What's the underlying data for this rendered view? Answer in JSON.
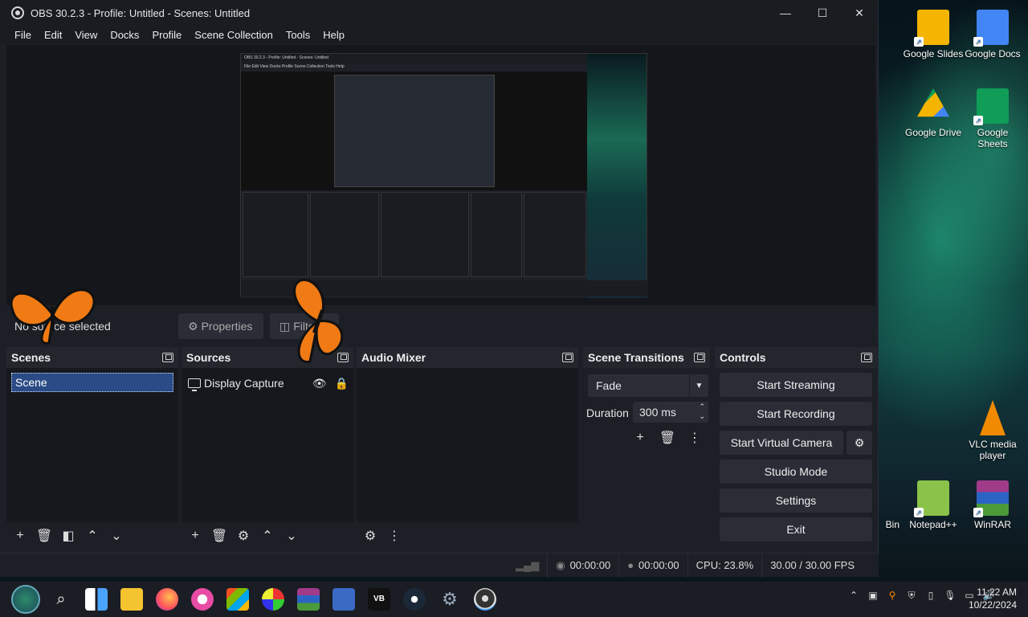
{
  "window": {
    "title": "OBS 30.2.3 - Profile: Untitled - Scenes: Untitled",
    "controls": [
      "—",
      "☐",
      "✕"
    ]
  },
  "menu": [
    "File",
    "Edit",
    "View",
    "Docks",
    "Profile",
    "Scene Collection",
    "Tools",
    "Help"
  ],
  "status_row": {
    "no_source": "No source selected",
    "properties_label": "Properties",
    "filters_label": "Filters"
  },
  "docks": {
    "scenes": {
      "title": "Scenes",
      "items": [
        "Scene"
      ]
    },
    "sources": {
      "title": "Sources",
      "items": [
        "Display Capture"
      ]
    },
    "audio_mixer": {
      "title": "Audio Mixer"
    },
    "transitions": {
      "title": "Scene Transitions",
      "selected": "Fade",
      "duration_label": "Duration",
      "duration_value": "300 ms"
    },
    "controls": {
      "title": "Controls",
      "buttons": [
        "Start Streaming",
        "Start Recording",
        "Start Virtual Camera",
        "Studio Mode",
        "Settings",
        "Exit"
      ]
    }
  },
  "statusbar": {
    "stream_time": "00:00:00",
    "record_time": "00:00:00",
    "cpu": "CPU: 23.8%",
    "fps": "30.00 / 30.00 FPS"
  },
  "desktop_icons": [
    {
      "label": "Google Slides",
      "color": "#f4b400"
    },
    {
      "label": "Google Docs",
      "color": "#4285f4"
    },
    {
      "label": "Google Drive",
      "color": "#0f9d58"
    },
    {
      "label": "Google Sheets",
      "color": "#0f9d58"
    },
    {
      "label": "VLC media player",
      "color": "#f08a00"
    },
    {
      "label": "Bin",
      "color": "#888888"
    },
    {
      "label": "Notepad++",
      "color": "#8bc34a"
    },
    {
      "label": "WinRAR",
      "color": "#a23a8a"
    }
  ],
  "mini_preview": {
    "title": "OBS 30.2.3 - Profile: Untitled - Scenes: Untitled",
    "menu": "File  Edit  View  Docks  Profile  Scene Collection  Tools  Help"
  },
  "clock": {
    "time": "11:22 AM",
    "date": "10/22/2024"
  }
}
